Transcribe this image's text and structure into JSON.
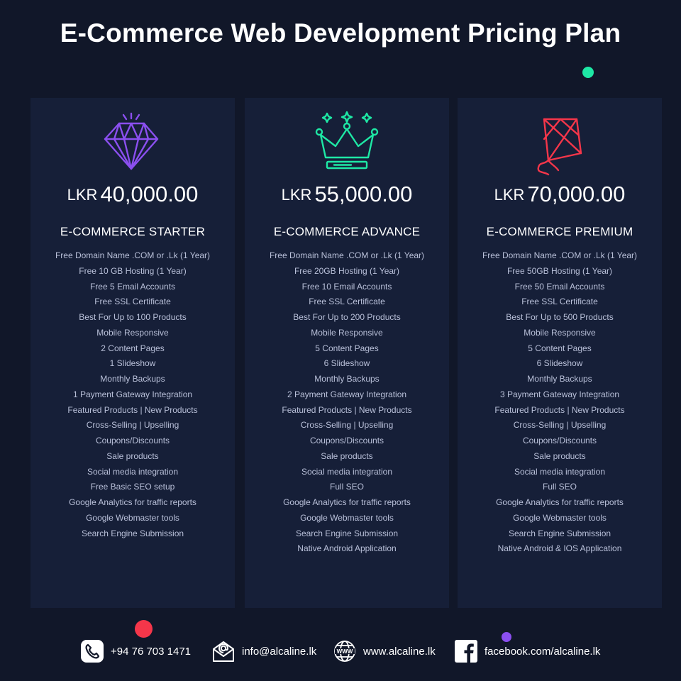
{
  "title": "E-Commerce Web Development Pricing Plan",
  "colors": {
    "background": "#111729",
    "card": "#161f38",
    "feature_text": "#b9c0d9",
    "diamond_icon": "#8b4ff0",
    "crown_icon": "#1ee8a5",
    "kite_icon": "#f5364a"
  },
  "plans": [
    {
      "icon": "diamond-icon",
      "currency": "LKR",
      "amount": "40,000.00",
      "name": "E-COMMERCE STARTER",
      "features": [
        "Free Domain Name .COM or .Lk (1 Year)",
        "Free 10 GB Hosting (1 Year)",
        "Free 5 Email Accounts",
        "Free SSL Certificate",
        "Best For Up to 100 Products",
        "Mobile Responsive",
        "2 Content Pages",
        "1 Slideshow",
        "Monthly Backups",
        "1 Payment Gateway Integration",
        "Featured Products | New Products",
        "Cross-Selling | Upselling",
        "Coupons/Discounts",
        "Sale products",
        "Social media integration",
        "Free Basic SEO setup",
        "Google Analytics for traffic reports",
        "Google Webmaster tools",
        "Search Engine Submission"
      ]
    },
    {
      "icon": "crown-icon",
      "currency": "LKR",
      "amount": "55,000.00",
      "name": "E-COMMERCE ADVANCE",
      "features": [
        "Free Domain Name .COM or .Lk (1 Year)",
        "Free 20GB Hosting (1 Year)",
        "Free 10 Email Accounts",
        "Free SSL Certificate",
        "Best For Up to 200 Products",
        "Mobile Responsive",
        "5 Content Pages",
        "6 Slideshow",
        "Monthly Backups",
        "2 Payment Gateway Integration",
        "Featured Products | New Products",
        "Cross-Selling | Upselling",
        "Coupons/Discounts",
        "Sale products",
        "Social media integration",
        "Full SEO",
        "Google Analytics for traffic reports",
        "Google Webmaster tools",
        "Search Engine Submission",
        "Native Android Application"
      ]
    },
    {
      "icon": "kite-icon",
      "currency": "LKR",
      "amount": "70,000.00",
      "name": "E-COMMERCE PREMIUM",
      "features": [
        "Free Domain Name .COM or .Lk (1 Year)",
        "Free 50GB Hosting (1 Year)",
        "Free 50 Email Accounts",
        "Free SSL Certificate",
        "Best For Up to 500 Products",
        "Mobile Responsive",
        "5 Content Pages",
        "6 Slideshow",
        "Monthly Backups",
        "3 Payment Gateway Integration",
        "Featured Products | New Products",
        "Cross-Selling | Upselling",
        "Coupons/Discounts",
        "Sale products",
        "Social media integration",
        "Full SEO",
        "Google Analytics for traffic reports",
        "Google Webmaster tools",
        "Search Engine Submission",
        "Native Android & IOS Application"
      ]
    }
  ],
  "contacts": {
    "phone": {
      "icon": "phone-icon",
      "text": "+94 76 703 1471"
    },
    "email": {
      "icon": "envelope-icon",
      "text": "info@alcaline.lk"
    },
    "web": {
      "icon": "globe-icon",
      "text": "www.alcaline.lk"
    },
    "facebook": {
      "icon": "facebook-icon",
      "text": "facebook.com/alcaline.lk"
    }
  }
}
